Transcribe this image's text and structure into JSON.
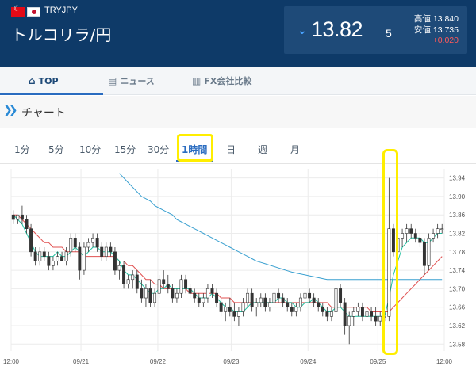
{
  "header": {
    "pair_code": "TRYJPY",
    "pair_name": "トルコリラ/円",
    "price_main": "13.82",
    "price_sub": "5",
    "high_label": "高値",
    "high_value": "13.840",
    "low_label": "安値",
    "low_value": "13.735",
    "change": "+0.020",
    "colors": {
      "bg": "#0e3a68",
      "down": "#4aa3ff",
      "up_change": "#ff5a5a"
    }
  },
  "tabs": [
    {
      "label": "TOP",
      "icon": "home-icon",
      "active": true
    },
    {
      "label": "ニュース",
      "icon": "newspaper-icon",
      "active": false
    },
    {
      "label": "FX会社比較",
      "icon": "building-icon",
      "active": false
    }
  ],
  "section": {
    "title": "チャート",
    "icon": "double-chevron-icon"
  },
  "timeframes": [
    {
      "label": "1分",
      "active": false
    },
    {
      "label": "5分",
      "active": false
    },
    {
      "label": "10分",
      "active": false
    },
    {
      "label": "15分",
      "active": false
    },
    {
      "label": "30分",
      "active": false
    },
    {
      "label": "1時間",
      "active": true
    },
    {
      "label": "日",
      "active": false
    },
    {
      "label": "週",
      "active": false
    },
    {
      "label": "月",
      "active": false
    }
  ],
  "chart_data": {
    "type": "candlestick",
    "y_ticks": [
      "13.94",
      "13.90",
      "13.86",
      "13.82",
      "13.78",
      "13.74",
      "13.70",
      "13.66",
      "13.62",
      "13.58"
    ],
    "ylim": [
      13.565,
      13.96
    ],
    "x_tick_labels": [
      "12:00",
      "09/21",
      "09/22",
      "09/23",
      "09/24",
      "09/25",
      "12:00"
    ],
    "grid": true,
    "ohlc": [
      [
        13.86,
        13.87,
        13.84,
        13.85
      ],
      [
        13.85,
        13.86,
        13.84,
        13.86
      ],
      [
        13.86,
        13.88,
        13.84,
        13.85
      ],
      [
        13.85,
        13.86,
        13.82,
        13.83
      ],
      [
        13.83,
        13.84,
        13.77,
        13.78
      ],
      [
        13.78,
        13.79,
        13.75,
        13.76
      ],
      [
        13.76,
        13.79,
        13.75,
        13.78
      ],
      [
        13.78,
        13.79,
        13.76,
        13.77
      ],
      [
        13.77,
        13.78,
        13.74,
        13.75
      ],
      [
        13.75,
        13.77,
        13.74,
        13.76
      ],
      [
        13.76,
        13.78,
        13.75,
        13.77
      ],
      [
        13.77,
        13.78,
        13.76,
        13.76
      ],
      [
        13.76,
        13.79,
        13.75,
        13.78
      ],
      [
        13.78,
        13.82,
        13.77,
        13.81
      ],
      [
        13.81,
        13.82,
        13.78,
        13.79
      ],
      [
        13.79,
        13.8,
        13.72,
        13.74
      ],
      [
        13.74,
        13.8,
        13.73,
        13.79
      ],
      [
        13.79,
        13.81,
        13.78,
        13.8
      ],
      [
        13.8,
        13.82,
        13.79,
        13.81
      ],
      [
        13.81,
        13.82,
        13.78,
        13.79
      ],
      [
        13.79,
        13.8,
        13.76,
        13.77
      ],
      [
        13.77,
        13.8,
        13.76,
        13.79
      ],
      [
        13.79,
        13.8,
        13.77,
        13.78
      ],
      [
        13.78,
        13.79,
        13.73,
        13.74
      ],
      [
        13.74,
        13.76,
        13.72,
        13.75
      ],
      [
        13.75,
        13.76,
        13.7,
        13.71
      ],
      [
        13.71,
        13.73,
        13.7,
        13.72
      ],
      [
        13.72,
        13.74,
        13.7,
        13.73
      ],
      [
        13.73,
        13.74,
        13.69,
        13.7
      ],
      [
        13.7,
        13.72,
        13.67,
        13.68
      ],
      [
        13.68,
        13.71,
        13.66,
        13.7
      ],
      [
        13.7,
        13.72,
        13.66,
        13.67
      ],
      [
        13.67,
        13.7,
        13.66,
        13.69
      ],
      [
        13.69,
        13.73,
        13.68,
        13.72
      ],
      [
        13.72,
        13.74,
        13.7,
        13.71
      ],
      [
        13.71,
        13.73,
        13.69,
        13.7
      ],
      [
        13.7,
        13.71,
        13.67,
        13.68
      ],
      [
        13.68,
        13.7,
        13.67,
        13.69
      ],
      [
        13.69,
        13.73,
        13.68,
        13.72
      ],
      [
        13.72,
        13.73,
        13.69,
        13.7
      ],
      [
        13.7,
        13.71,
        13.68,
        13.69
      ],
      [
        13.69,
        13.7,
        13.67,
        13.68
      ],
      [
        13.68,
        13.69,
        13.66,
        13.67
      ],
      [
        13.67,
        13.69,
        13.66,
        13.68
      ],
      [
        13.68,
        13.71,
        13.67,
        13.7
      ],
      [
        13.7,
        13.71,
        13.68,
        13.69
      ],
      [
        13.69,
        13.7,
        13.66,
        13.67
      ],
      [
        13.67,
        13.68,
        13.64,
        13.65
      ],
      [
        13.65,
        13.67,
        13.63,
        13.66
      ],
      [
        13.66,
        13.68,
        13.64,
        13.65
      ],
      [
        13.65,
        13.67,
        13.63,
        13.64
      ],
      [
        13.64,
        13.66,
        13.62,
        13.65
      ],
      [
        13.65,
        13.68,
        13.64,
        13.67
      ],
      [
        13.67,
        13.7,
        13.66,
        13.69
      ],
      [
        13.69,
        13.7,
        13.65,
        13.66
      ],
      [
        13.66,
        13.68,
        13.64,
        13.67
      ],
      [
        13.67,
        13.69,
        13.66,
        13.68
      ],
      [
        13.68,
        13.69,
        13.65,
        13.66
      ],
      [
        13.66,
        13.68,
        13.65,
        13.67
      ],
      [
        13.67,
        13.7,
        13.66,
        13.69
      ],
      [
        13.69,
        13.7,
        13.67,
        13.68
      ],
      [
        13.68,
        13.69,
        13.66,
        13.67
      ],
      [
        13.67,
        13.68,
        13.65,
        13.66
      ],
      [
        13.66,
        13.67,
        13.64,
        13.65
      ],
      [
        13.65,
        13.67,
        13.64,
        13.66
      ],
      [
        13.66,
        13.69,
        13.65,
        13.68
      ],
      [
        13.68,
        13.7,
        13.67,
        13.69
      ],
      [
        13.69,
        13.7,
        13.67,
        13.68
      ],
      [
        13.68,
        13.69,
        13.66,
        13.67
      ],
      [
        13.67,
        13.68,
        13.65,
        13.66
      ],
      [
        13.66,
        13.67,
        13.64,
        13.65
      ],
      [
        13.65,
        13.66,
        13.63,
        13.64
      ],
      [
        13.64,
        13.66,
        13.63,
        13.65
      ],
      [
        13.65,
        13.71,
        13.64,
        13.7
      ],
      [
        13.7,
        13.71,
        13.66,
        13.67
      ],
      [
        13.67,
        13.68,
        13.6,
        13.62
      ],
      [
        13.62,
        13.65,
        13.58,
        13.64
      ],
      [
        13.64,
        13.66,
        13.62,
        13.65
      ],
      [
        13.65,
        13.67,
        13.64,
        13.66
      ],
      [
        13.66,
        13.67,
        13.63,
        13.64
      ],
      [
        13.64,
        13.66,
        13.62,
        13.65
      ],
      [
        13.65,
        13.66,
        13.63,
        13.64
      ],
      [
        13.64,
        13.66,
        13.62,
        13.63
      ],
      [
        13.63,
        13.65,
        13.62,
        13.64
      ],
      [
        13.64,
        13.65,
        13.63,
        13.64
      ],
      [
        13.64,
        13.94,
        13.63,
        13.83
      ],
      [
        13.83,
        13.84,
        13.77,
        13.78
      ],
      [
        13.78,
        13.82,
        13.77,
        13.81
      ],
      [
        13.81,
        13.83,
        13.79,
        13.82
      ],
      [
        13.82,
        13.84,
        13.8,
        13.83
      ],
      [
        13.83,
        13.84,
        13.81,
        13.82
      ],
      [
        13.82,
        13.83,
        13.8,
        13.81
      ],
      [
        13.81,
        13.82,
        13.79,
        13.8
      ],
      [
        13.8,
        13.81,
        13.73,
        13.75
      ],
      [
        13.75,
        13.82,
        13.74,
        13.81
      ],
      [
        13.81,
        13.83,
        13.8,
        13.82
      ],
      [
        13.82,
        13.84,
        13.81,
        13.83
      ],
      [
        13.83,
        13.84,
        13.82,
        13.83
      ]
    ],
    "ma_short": [
      13.86,
      13.85,
      13.84,
      13.82,
      13.8,
      13.78,
      13.77,
      13.77,
      13.77,
      13.77,
      13.78,
      13.77,
      13.77,
      13.78,
      13.79,
      13.78,
      13.77,
      13.78,
      13.79,
      13.79,
      13.78,
      13.78,
      13.78,
      13.77,
      13.76,
      13.74,
      13.73,
      13.73,
      13.72,
      13.71,
      13.7,
      13.69,
      13.69,
      13.7,
      13.7,
      13.71,
      13.7,
      13.7,
      13.7,
      13.7,
      13.7,
      13.69,
      13.68,
      13.68,
      13.68,
      13.69,
      13.68,
      13.67,
      13.66,
      13.66,
      13.65,
      13.65,
      13.65,
      13.66,
      13.67,
      13.67,
      13.67,
      13.67,
      13.67,
      13.67,
      13.68,
      13.68,
      13.67,
      13.67,
      13.66,
      13.66,
      13.67,
      13.67,
      13.68,
      13.67,
      13.66,
      13.65,
      13.65,
      13.66,
      13.66,
      13.65,
      13.64,
      13.64,
      13.64,
      13.64,
      13.64,
      13.64,
      13.64,
      13.64,
      13.64,
      13.68,
      13.73,
      13.76,
      13.79,
      13.8,
      13.81,
      13.81,
      13.81,
      13.8,
      13.8,
      13.81,
      13.82,
      13.82
    ],
    "ma_mid": [
      13.86,
      13.86,
      13.85,
      13.84,
      13.83,
      13.82,
      13.81,
      13.8,
      13.8,
      13.79,
      13.79,
      13.79,
      13.78,
      13.78,
      13.78,
      13.78,
      13.77,
      13.77,
      13.77,
      13.77,
      13.77,
      13.77,
      13.77,
      13.77,
      13.76,
      13.76,
      13.75,
      13.75,
      13.74,
      13.73,
      13.72,
      13.72,
      13.71,
      13.71,
      13.7,
      13.7,
      13.7,
      13.7,
      13.7,
      13.7,
      13.69,
      13.69,
      13.69,
      13.69,
      13.69,
      13.69,
      13.69,
      13.68,
      13.68,
      13.68,
      13.67,
      13.67,
      13.67,
      13.67,
      13.67,
      13.67,
      13.67,
      13.67,
      13.67,
      13.67,
      13.67,
      13.67,
      13.67,
      13.67,
      13.67,
      13.67,
      13.67,
      13.67,
      13.67,
      13.67,
      13.67,
      13.67,
      13.66,
      13.66,
      13.66,
      13.66,
      13.66,
      13.66,
      13.66,
      13.66,
      13.66,
      13.65,
      13.65,
      13.65,
      13.65,
      13.65,
      13.66,
      13.67,
      13.68,
      13.69,
      13.7,
      13.71,
      13.72,
      13.73,
      13.74,
      13.75,
      13.76,
      13.77
    ],
    "ma_long": [
      null,
      null,
      null,
      null,
      null,
      null,
      null,
      null,
      null,
      null,
      null,
      null,
      null,
      null,
      null,
      null,
      null,
      null,
      null,
      null,
      null,
      null,
      null,
      null,
      13.95,
      13.94,
      13.93,
      13.92,
      13.91,
      13.9,
      13.895,
      13.89,
      13.88,
      13.875,
      13.87,
      13.865,
      13.86,
      13.85,
      13.845,
      13.84,
      13.835,
      13.83,
      13.825,
      13.82,
      13.815,
      13.81,
      13.805,
      13.8,
      13.795,
      13.79,
      13.785,
      13.78,
      13.775,
      13.77,
      13.765,
      13.76,
      13.757,
      13.754,
      13.751,
      13.748,
      13.745,
      13.742,
      13.739,
      13.736,
      13.734,
      13.732,
      13.73,
      13.728,
      13.726,
      13.724,
      13.722,
      13.72,
      13.72,
      13.72,
      13.72,
      13.72,
      13.72,
      13.72,
      13.72,
      13.72,
      13.72,
      13.72,
      13.72,
      13.72,
      13.72,
      13.72,
      13.72,
      13.72,
      13.72,
      13.72,
      13.72,
      13.72,
      13.72,
      13.72,
      13.72,
      13.72,
      13.72,
      13.72
    ],
    "colors": {
      "candle": "#333333",
      "ma_short": "#20c0a0",
      "ma_mid": "#e05050",
      "ma_long": "#3aa0d0",
      "grid": "#ececec"
    }
  }
}
